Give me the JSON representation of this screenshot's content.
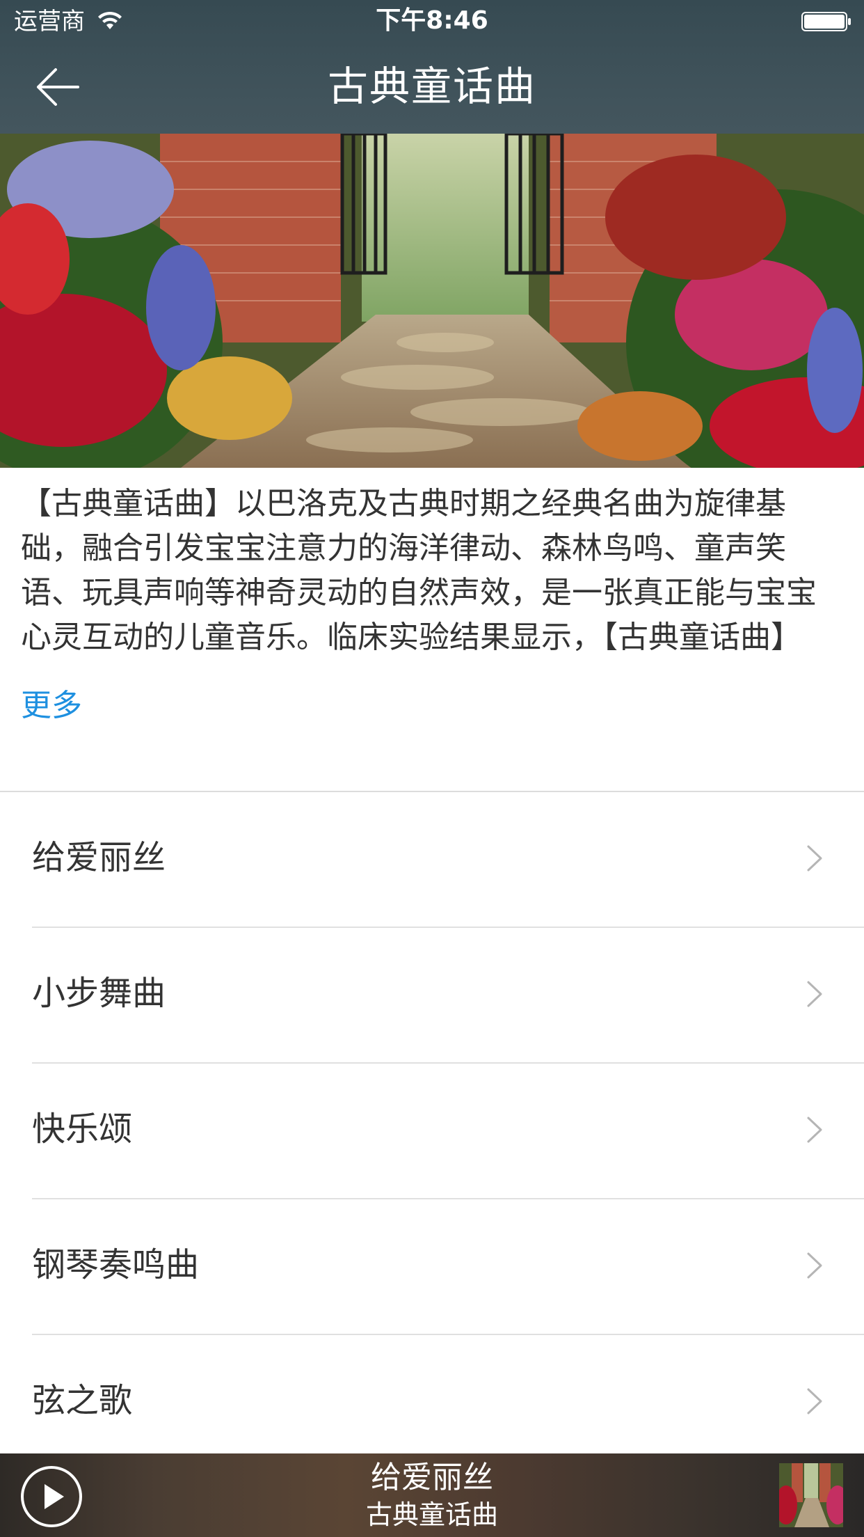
{
  "status_bar": {
    "carrier": "运营商",
    "time": "下午8:46"
  },
  "nav": {
    "title": "古典童话曲"
  },
  "description": {
    "text": "【古典童话曲】以巴洛克及古典时期之经典名曲为旋律基础，融合引发宝宝注意力的海洋律动、森林鸟鸣、童声笑语、玩具声响等神奇灵动的自然声效，是一张真正能与宝宝心灵互动的儿童音乐。临床实验结果显示，【古典童话曲】",
    "more_label": "更多"
  },
  "tracks": [
    {
      "title": "给爱丽丝"
    },
    {
      "title": "小步舞曲"
    },
    {
      "title": "快乐颂"
    },
    {
      "title": "钢琴奏鸣曲"
    },
    {
      "title": "弦之歌"
    }
  ],
  "player": {
    "now_playing_title": "给爱丽丝",
    "now_playing_album": "古典童话曲"
  },
  "colors": {
    "header_bg": "#3f525a",
    "link": "#1e90e0",
    "divider": "#dcdcdc"
  }
}
